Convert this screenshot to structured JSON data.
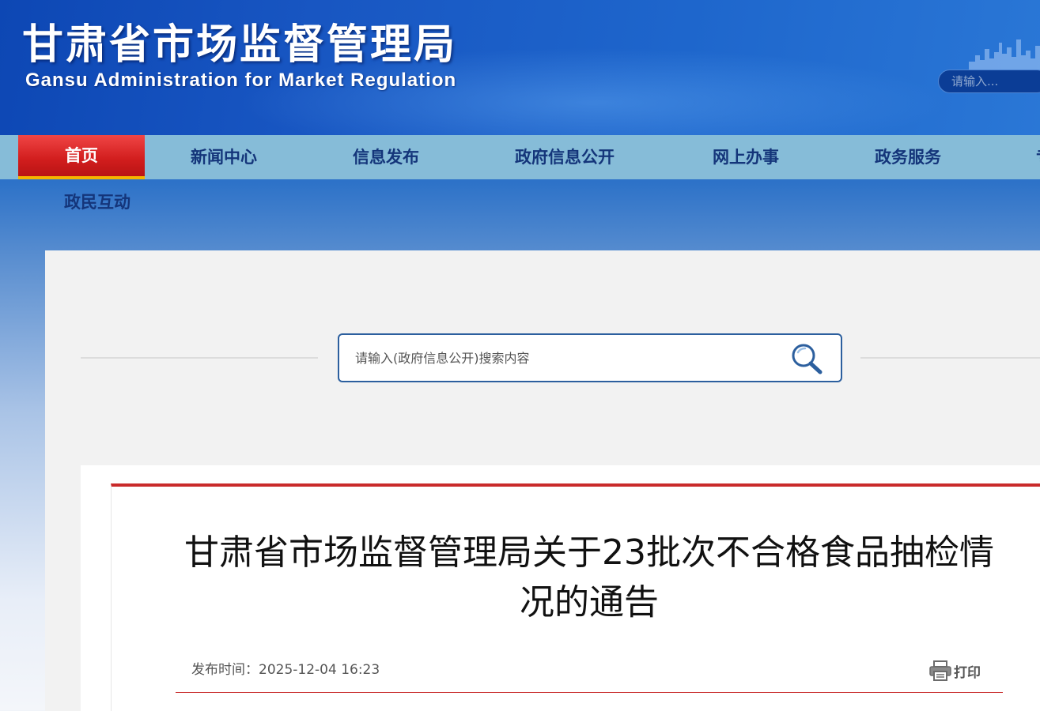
{
  "header": {
    "title_cn": "甘肃省市场监督管理局",
    "title_en": "Gansu Administration for Market Regulation",
    "search_placeholder": "请输入..."
  },
  "nav": {
    "items": [
      {
        "label": "首页",
        "active": true
      },
      {
        "label": "新闻中心"
      },
      {
        "label": "信息发布"
      },
      {
        "label": "政府信息公开"
      },
      {
        "label": "网上办事"
      },
      {
        "label": "政务服务"
      },
      {
        "label": "专"
      }
    ],
    "row2_label": "政民互动"
  },
  "search": {
    "placeholder": "请输入(政府信息公开)搜索内容",
    "icon": "search-icon"
  },
  "article": {
    "title": "甘肃省市场监督管理局关于23批次不合格食品抽检情况的通告",
    "publish_label": "发布时间：",
    "publish_time": "2025-12-04 16:23",
    "print_label": "打印",
    "print_icon": "printer-icon"
  },
  "colors": {
    "header_blue": "#1856c2",
    "nav_bg": "#86bcd8",
    "nav_text": "#14357a",
    "active_red": "#d11d1d",
    "accent_yellow": "#f5b400",
    "article_red": "#c92a2a",
    "search_border": "#2c5f9e"
  }
}
